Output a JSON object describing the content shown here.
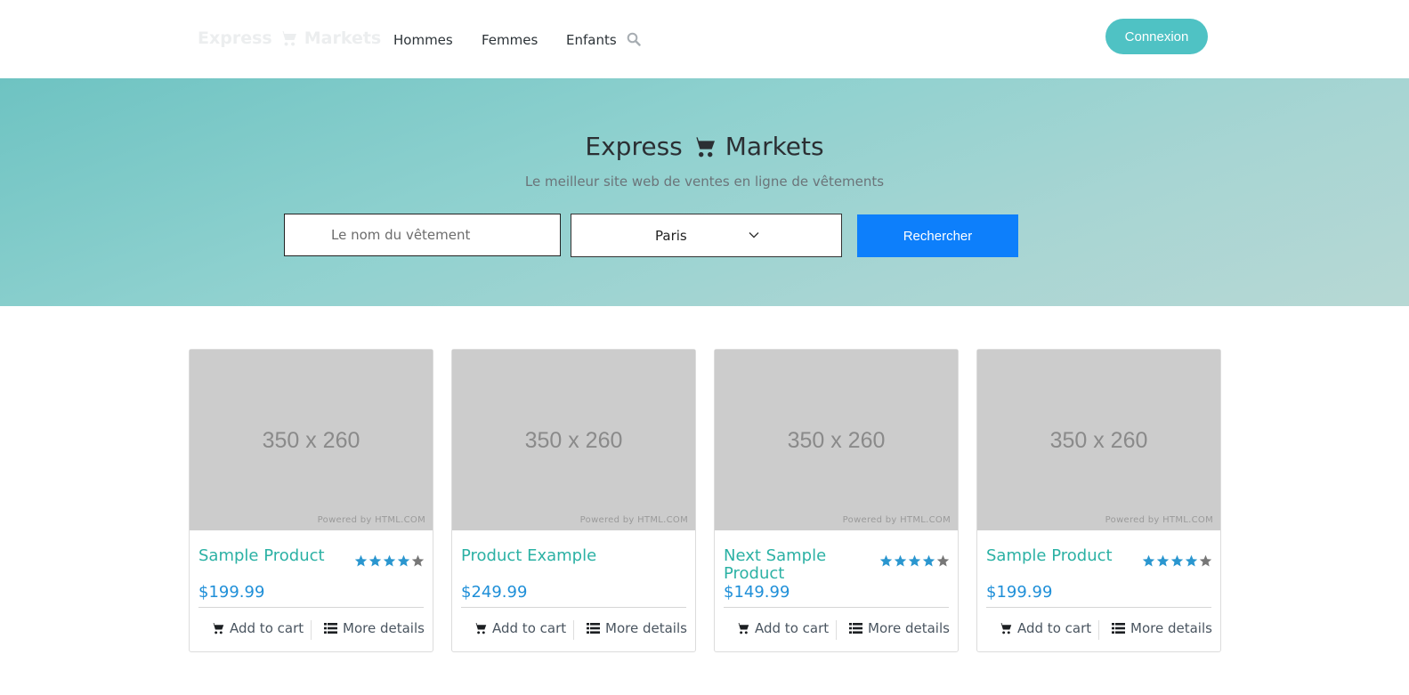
{
  "navbar": {
    "brand_left": "Express",
    "brand_right": "Markets",
    "links": [
      "Hommes",
      "Femmes",
      "Enfants"
    ],
    "login_label": "Connexion"
  },
  "hero": {
    "title_left": "Express",
    "title_right": "Markets",
    "subtitle": "Le meilleur site web de ventes en ligne de vêtements",
    "search_placeholder": "Le nom du vêtement",
    "city_value": "Paris",
    "search_button": "Rechercher"
  },
  "products": [
    {
      "title": "Sample Product",
      "price": "$199.99",
      "image_label": "350 x 260",
      "powered": "Powered by HTML.COM",
      "rating": 4,
      "max_rating": 5,
      "show_rating": true,
      "add_label": "Add to cart",
      "details_label": "More details"
    },
    {
      "title": "Product Example",
      "price": "$249.99",
      "image_label": "350 x 260",
      "powered": "Powered by HTML.COM",
      "rating": 0,
      "max_rating": 5,
      "show_rating": false,
      "add_label": "Add to cart",
      "details_label": "More details"
    },
    {
      "title": "Next Sample Product",
      "price": "$149.99",
      "image_label": "350 x 260",
      "powered": "Powered by HTML.COM",
      "rating": 4,
      "max_rating": 5,
      "show_rating": true,
      "add_label": "Add to cart",
      "details_label": "More details"
    },
    {
      "title": "Sample Product",
      "price": "$199.99",
      "image_label": "350 x 260",
      "powered": "Powered by HTML.COM",
      "rating": 4,
      "max_rating": 5,
      "show_rating": true,
      "add_label": "Add to cart",
      "details_label": "More details"
    }
  ],
  "colors": {
    "accent": "#4fc2c4",
    "primary_button": "#0d7ffb",
    "title": "#2bb1a4",
    "price": "#1f8fd8",
    "star_filled": "#2a96cf",
    "star_empty": "#777777"
  },
  "icons": {
    "cart": "shopping-cart-icon",
    "search": "search-icon",
    "chevron": "chevron-down-icon",
    "list": "list-icon",
    "star": "star-icon"
  }
}
